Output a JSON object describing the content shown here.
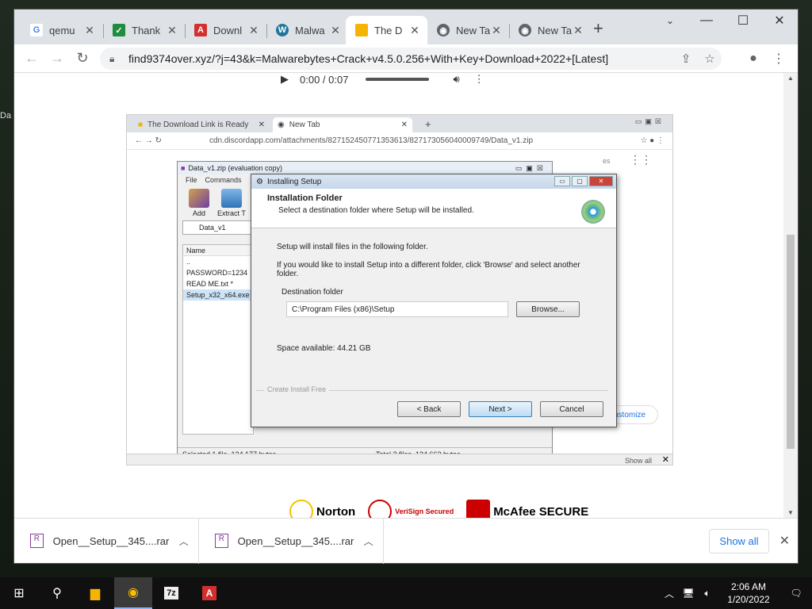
{
  "desktop": {
    "side_text": "Da"
  },
  "browser": {
    "tabs": [
      {
        "title": "qemu",
        "favicon": "google-icon",
        "color": "#4285f4",
        "glyph": "G"
      },
      {
        "title": "Thank",
        "favicon": "check-icon",
        "color": "#1e8e3e",
        "glyph": "✓"
      },
      {
        "title": "Downl",
        "favicon": "avira-icon",
        "color": "#d32f2f",
        "glyph": "A"
      },
      {
        "title": "Malwa",
        "favicon": "wordpress-icon",
        "color": "#21759b",
        "glyph": "W"
      },
      {
        "title": "The D",
        "favicon": "folder-icon",
        "color": "#f4b400",
        "glyph": ""
      },
      {
        "title": "New Ta",
        "favicon": "chrome-icon",
        "color": "#5f6368",
        "glyph": "◉"
      },
      {
        "title": "New Ta",
        "favicon": "chrome-icon",
        "color": "#5f6368",
        "glyph": "◉"
      }
    ],
    "url": "find9374over.xyz/?j=43&k=Malwarebytes+Crack+v4.5.0.256+With+Key+Download+2022+[Latest]"
  },
  "page": {
    "audio": {
      "time": "0:00 / 0:07"
    },
    "embedded": {
      "tabs": [
        "The Download Link is Ready",
        "New Tab"
      ],
      "url": "cdn.discordapp.com/attachments/827152450771353613/827173056040009749/Data_v1.zip",
      "right_text": "es",
      "customize": "ustomize",
      "show_all": "Show all",
      "winrar": {
        "title": "Data_v1.zip (evaluation copy)",
        "menu": [
          "File",
          "Commands"
        ],
        "buttons": [
          "Add",
          "Extract T"
        ],
        "path": "Data_v1",
        "column": "Name",
        "files": [
          "..",
          "PASSWORD=1234",
          "READ ME.txt *",
          "Setup_x32_x64.exe"
        ],
        "status_left": "Selected 1 file, 124,177 bytes",
        "status_right": "Total 3 files, 124,663 bytes"
      },
      "setup": {
        "title": "Installing Setup",
        "heading": "Installation Folder",
        "subheading": "Select a destination folder where Setup will be installed.",
        "line1": "Setup will install files in the following folder.",
        "line2": "If you would like to install Setup into a different folder, click 'Browse' and select another folder.",
        "dest_label": "Destination folder",
        "dest_value": "C:\\Program Files (x86)\\Setup",
        "browse": "Browse...",
        "space": "Space available: 44.21 GB",
        "footer": "Create Install Free",
        "back": "< Back",
        "next": "Next >",
        "cancel": "Cancel"
      }
    },
    "badges": [
      "Norton",
      "VeriSign Secured",
      "McAfee SECURE"
    ]
  },
  "downloads": {
    "items": [
      "Open__Setup__345....rar",
      "Open__Setup__345....rar"
    ],
    "show_all": "Show all"
  },
  "taskbar": {
    "time": "2:06 AM",
    "date": "1/20/2022"
  }
}
